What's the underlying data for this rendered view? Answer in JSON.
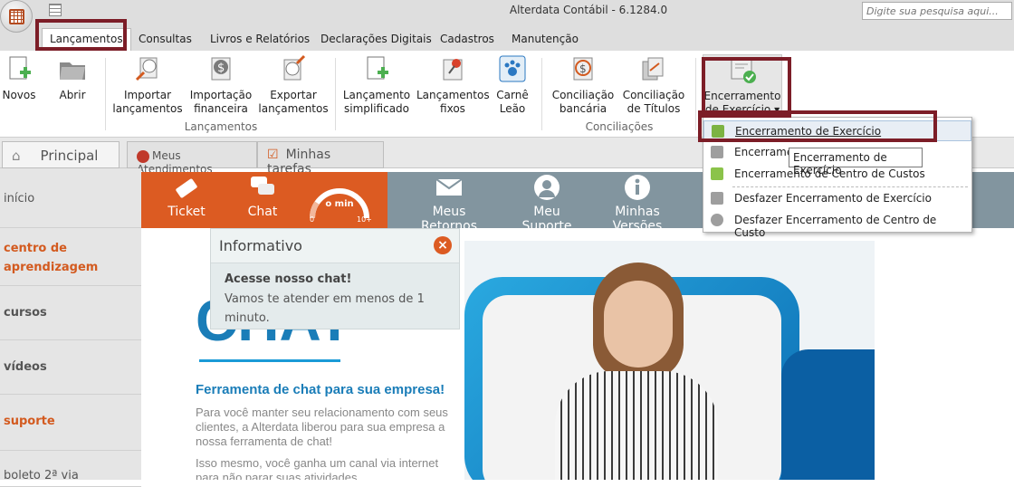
{
  "window": {
    "title": "Alterdata Contábil - 6.1284.0",
    "search_placeholder": "Digite sua pesquisa aqui..."
  },
  "tabs": [
    "Lançamentos",
    "Consultas",
    "Livros e Relatórios",
    "Declarações Digitais",
    "Cadastros",
    "Manutenção"
  ],
  "ribbon": {
    "buttons": [
      {
        "l1": "Novos",
        "l2": ""
      },
      {
        "l1": "Abrir",
        "l2": ""
      },
      {
        "l1": "Importar",
        "l2": "lançamentos"
      },
      {
        "l1": "Importação",
        "l2": "financeira"
      },
      {
        "l1": "Exportar",
        "l2": "lançamentos"
      },
      {
        "l1": "Lançamento",
        "l2": "simplificado"
      },
      {
        "l1": "Lançamentos",
        "l2": "fixos"
      },
      {
        "l1": "Carnê",
        "l2": "Leão"
      },
      {
        "l1": "Conciliação",
        "l2": "bancária"
      },
      {
        "l1": "Conciliação",
        "l2": "de Títulos"
      },
      {
        "l1": "Encerramento",
        "l2": "de Exercício ▾"
      }
    ],
    "groups": [
      "Lançamentos",
      "Conciliações"
    ]
  },
  "subtabs": [
    "Principal",
    "Meus Atendimentos",
    "Minhas tarefas"
  ],
  "sidebar": [
    "início",
    "centro de aprendizagem",
    "cursos",
    "vídeos",
    "suporte",
    "boleto 2ª via"
  ],
  "nav": {
    "ticket": "Ticket",
    "chat": "Chat",
    "gauge": "o min",
    "gauge_min": "0",
    "gauge_max": "10+",
    "retornos": "Meus Retornos",
    "suporte": "Meu Suporte",
    "versoes": "Minhas Versões"
  },
  "popup": {
    "title": "Informativo",
    "bold": "Acesse nosso chat!",
    "text": "Vamos te atender em menos de 1 minuto."
  },
  "content": {
    "heading": "CHAT",
    "subtitle": "Ferramenta de chat para sua empresa!",
    "p1": "Para você manter seu relacionamento com seus clientes, a Alterdata liberou para sua empresa a nossa ferramenta de chat!",
    "p2": "Isso mesmo, você ganha um canal via internet para não parar suas atividades."
  },
  "menu": [
    "Encerramento de Exercício",
    "Encerramento",
    "Encerramento de Centro de Custos",
    "Desfazer Encerramento de Exercício",
    "Desfazer Encerramento de Centro de Custo"
  ],
  "tooltip": "Encerramento de Exercício",
  "colors": {
    "accent": "#dc5b22",
    "highlight": "#7c1d27",
    "nav_grey": "#82959f",
    "heading_blue": "#1a7db8"
  }
}
